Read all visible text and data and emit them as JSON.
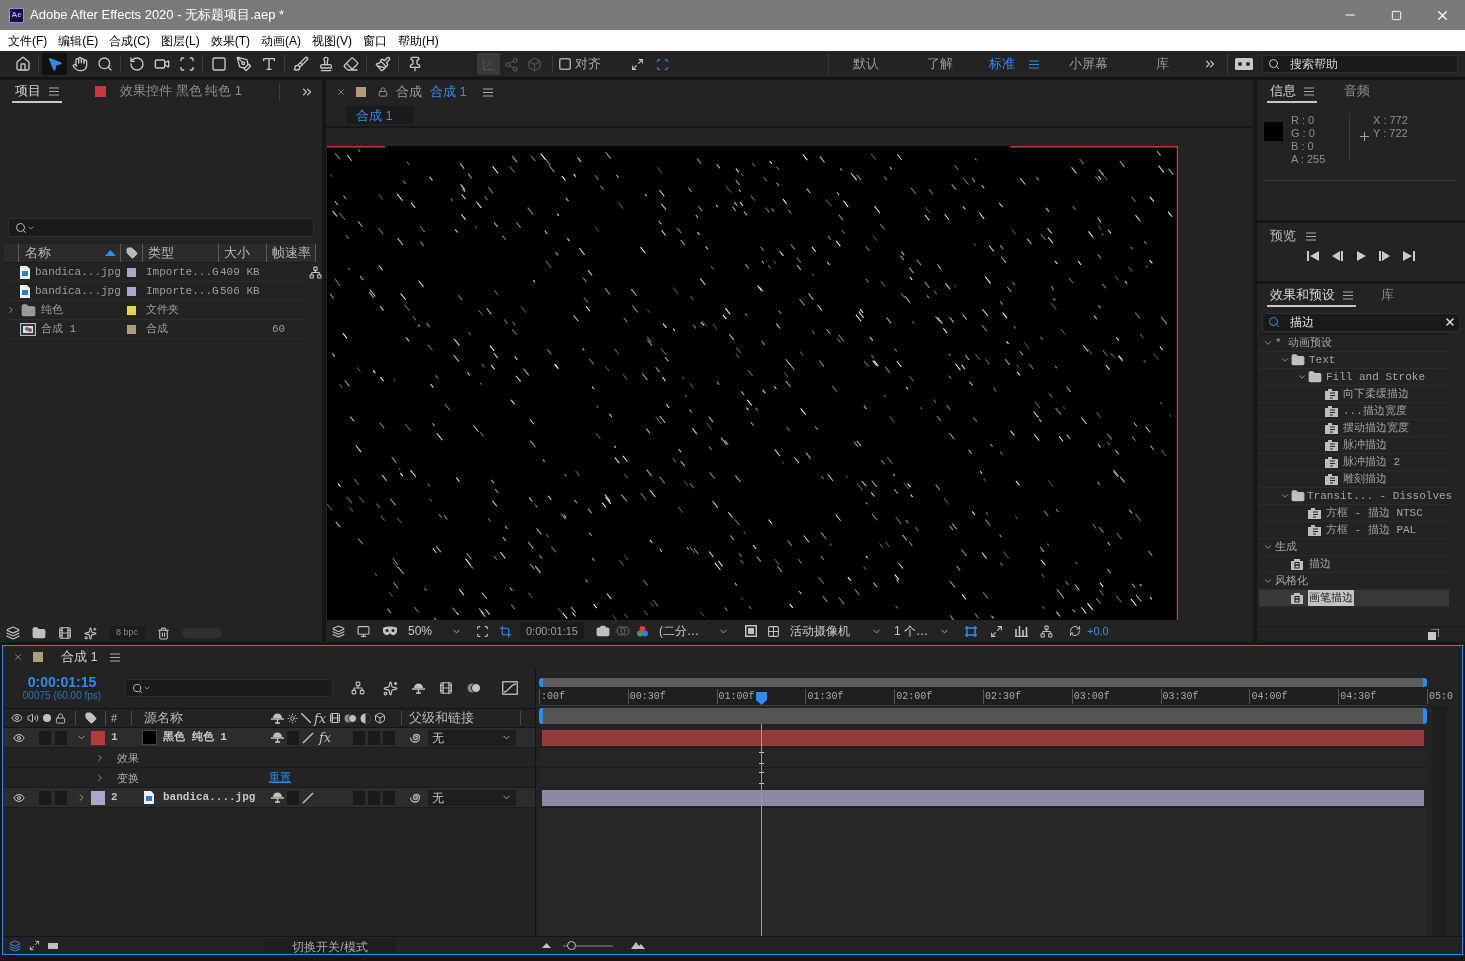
{
  "window": {
    "app_badge": "Ae",
    "title": "Adobe After Effects 2020 - 无标题项目.aep *"
  },
  "menu": [
    "文件(F)",
    "编辑(E)",
    "合成(C)",
    "图层(L)",
    "效果(T)",
    "动画(A)",
    "视图(V)",
    "窗口",
    "帮助(H)"
  ],
  "toolbar": {
    "tools": [
      {
        "kind": "home",
        "selected": false
      },
      {
        "kind": "selection",
        "selected": true
      },
      {
        "kind": "hand",
        "selected": false
      },
      {
        "kind": "zoom",
        "selected": false
      },
      {
        "kind": "rotate",
        "selected": false
      },
      {
        "kind": "camera",
        "selected": false
      },
      {
        "kind": "pan",
        "selected": false
      },
      {
        "kind": "rectangle",
        "selected": false
      },
      {
        "kind": "pen",
        "selected": false
      },
      {
        "kind": "text",
        "selected": false
      },
      {
        "kind": "brush",
        "selected": false
      },
      {
        "kind": "stamp",
        "selected": false
      },
      {
        "kind": "eraser",
        "selected": false
      },
      {
        "kind": "roto",
        "selected": false
      },
      {
        "kind": "pin",
        "selected": false
      }
    ],
    "axis_modes": [
      {
        "kind": "local",
        "selected": true,
        "disabled": true
      },
      {
        "kind": "world",
        "selected": false,
        "disabled": true
      },
      {
        "kind": "view",
        "selected": false,
        "disabled": true
      }
    ],
    "snap": {
      "label": "对齐",
      "checked": false
    },
    "workspaces": [
      {
        "label": "默认",
        "selected": false
      },
      {
        "label": "了解",
        "selected": false
      },
      {
        "label": "标准",
        "selected": true
      },
      {
        "label": "小屏幕",
        "selected": false
      },
      {
        "label": "库",
        "selected": false
      }
    ],
    "help_search": {
      "placeholder": "搜索帮助"
    }
  },
  "project_panel": {
    "tabs": [
      {
        "label": "项目",
        "selected": true
      },
      {
        "label": "效果控件 黑色 纯色 1",
        "selected": false,
        "color": "#c4393b"
      }
    ],
    "columns": [
      "名称",
      "类型",
      "大小",
      "帧速率"
    ],
    "rows": [
      {
        "kind": "image",
        "name": "bandica...jpg",
        "color": "#a9a8cc",
        "type": "Importe...G",
        "size": "409 KB"
      },
      {
        "kind": "image",
        "name": "bandica...jpg",
        "color": "#a9a8cc",
        "type": "Importe...G",
        "size": "506 KB"
      },
      {
        "kind": "folder",
        "name": "纯色",
        "color": "#e3d84a",
        "type": "文件夹",
        "expanded": false
      },
      {
        "kind": "composition",
        "name": "合成 1",
        "color": "#b09c7d",
        "type": "合成",
        "fps": "60"
      }
    ],
    "bit_depth": "8 bpc"
  },
  "viewer": {
    "tab": {
      "label": "合成",
      "comp": "合成 1",
      "color": "#b09c7d"
    },
    "breadcrumb": "合成 1",
    "zoom": "50%",
    "timecode": "0:00:01:15",
    "resolution": "(二分…",
    "camera": "活动摄像机",
    "views": "1 个…",
    "exposure": "+0.0"
  },
  "info_panel": {
    "tabs": [
      {
        "label": "信息",
        "selected": true
      },
      {
        "label": "音频",
        "selected": false
      }
    ],
    "color": "#000000",
    "channels": [
      "R : 0",
      "G : 0",
      "B : 0",
      "A : 255"
    ],
    "coords": [
      "X : 772",
      "Y : 722"
    ]
  },
  "preview_panel": {
    "title": "预览"
  },
  "effects_panel": {
    "tabs": [
      {
        "label": "效果和预设",
        "selected": true
      },
      {
        "label": "库",
        "selected": false
      }
    ],
    "search": {
      "value": "描边"
    },
    "tree": [
      {
        "label": "* 动画预设",
        "kind": "category",
        "expanded": true,
        "selected": false,
        "children": [
          {
            "label": "Text",
            "kind": "folder",
            "expanded": true,
            "selected": false,
            "children": [
              {
                "label": "Fill and Stroke",
                "kind": "folder",
                "expanded": true,
                "selected": false,
                "children": [
                  {
                    "label": "向下柔缓描边",
                    "kind": "preset",
                    "selected": false
                  },
                  {
                    "label": "...描边宽度",
                    "kind": "preset",
                    "selected": false
                  },
                  {
                    "label": "摆动描边宽度",
                    "kind": "preset",
                    "selected": false
                  },
                  {
                    "label": "脉冲描边",
                    "kind": "preset",
                    "selected": false
                  },
                  {
                    "label": "脉冲描边 2",
                    "kind": "preset",
                    "selected": false
                  },
                  {
                    "label": "雕刻描边",
                    "kind": "preset",
                    "selected": false
                  }
                ]
              }
            ]
          },
          {
            "label": "Transit... - Dissolves",
            "kind": "folder",
            "expanded": true,
            "selected": false,
            "children": [
              {
                "label": "方框 - 描边 NTSC",
                "kind": "preset",
                "selected": false
              },
              {
                "label": "方框 - 描边 PAL",
                "kind": "preset",
                "selected": false
              }
            ]
          }
        ]
      },
      {
        "label": "生成",
        "kind": "category",
        "expanded": true,
        "selected": false,
        "children": [
          {
            "label": "描边",
            "kind": "effect",
            "selected": false
          }
        ]
      },
      {
        "label": "风格化",
        "kind": "category",
        "expanded": true,
        "selected": false,
        "children": [
          {
            "label": "画笔描边",
            "kind": "effect",
            "selected": true
          }
        ]
      }
    ]
  },
  "timeline": {
    "tab": {
      "label": "合成 1",
      "color": "#b09c7d"
    },
    "timecode": "0:00:01:15",
    "frame_info": "00075 (60.00 fps)",
    "columns": {
      "number": "#",
      "source": "源名称",
      "fx": "fx",
      "parent": "父级和链接"
    },
    "ruler": [
      ":00f",
      "00:30f",
      "01:00f",
      "01:30f",
      "02:00f",
      "02:30f",
      "03:00f",
      "03:30f",
      "04:00f",
      "04:30f",
      "05:0"
    ],
    "playhead": {
      "level": 0.25
    },
    "layers": [
      {
        "number": "1",
        "name": "黑色 纯色 1",
        "kind": "solid",
        "color": "#b53a3c",
        "visible": true,
        "expanded": true,
        "fx": "fx",
        "effects_on": true,
        "parent": "无",
        "properties": [
          {
            "label": "效果",
            "expanded": false
          },
          {
            "label": "变换",
            "expanded": false,
            "link": "重置"
          }
        ]
      },
      {
        "number": "2",
        "name": "bandica....jpg",
        "kind": "image",
        "color": "#a9a7cc",
        "visible": true,
        "expanded": false,
        "parent": "无"
      }
    ],
    "mode_toggle": "切换开关/模式",
    "zoom_slider": {
      "level": 0.15
    }
  }
}
